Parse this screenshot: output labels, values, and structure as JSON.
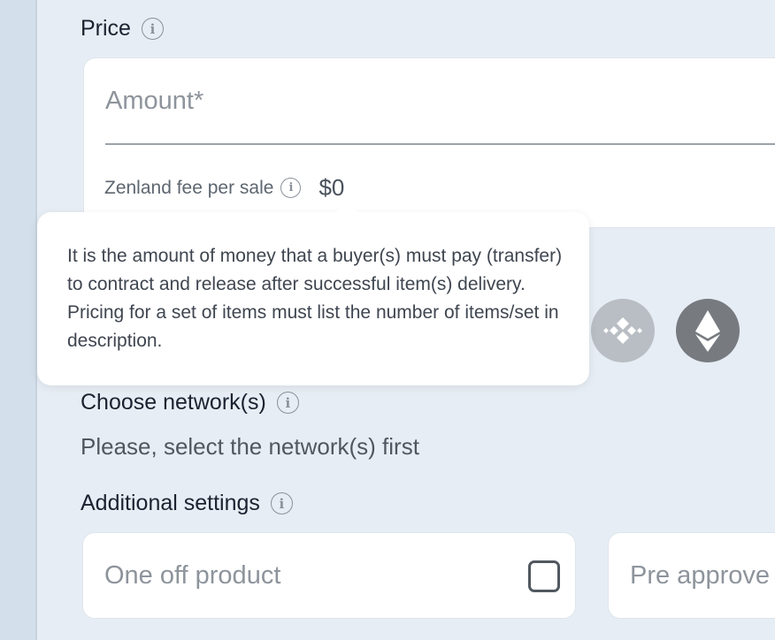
{
  "price": {
    "title": "Price",
    "info_icon": "info-icon"
  },
  "amount": {
    "placeholder": "Amount*"
  },
  "fee": {
    "label": "Zenland fee per sale",
    "value": "$0",
    "info_icon": "info-icon"
  },
  "tooltip": {
    "text": "It is the amount of money that a buyer(s) must pay (transfer) to contract and release after successful item(s) delivery. Pricing for a set of items must list the number of items/set in description."
  },
  "coins": [
    {
      "name": "bnb-coin-icon",
      "color": "#b9bec4"
    },
    {
      "name": "ethereum-coin-icon",
      "color": "#777b80"
    }
  ],
  "network": {
    "title": "Choose network(s)",
    "hint": "Please, select the network(s) first"
  },
  "additional": {
    "title": "Additional settings",
    "options": [
      {
        "label": "One off product",
        "checked": false
      },
      {
        "label": "Pre approve"
      }
    ]
  },
  "colors": {
    "background": "#e7edf4",
    "card": "#ffffff",
    "placeholder": "#8e949c",
    "text": "#1b2230"
  }
}
